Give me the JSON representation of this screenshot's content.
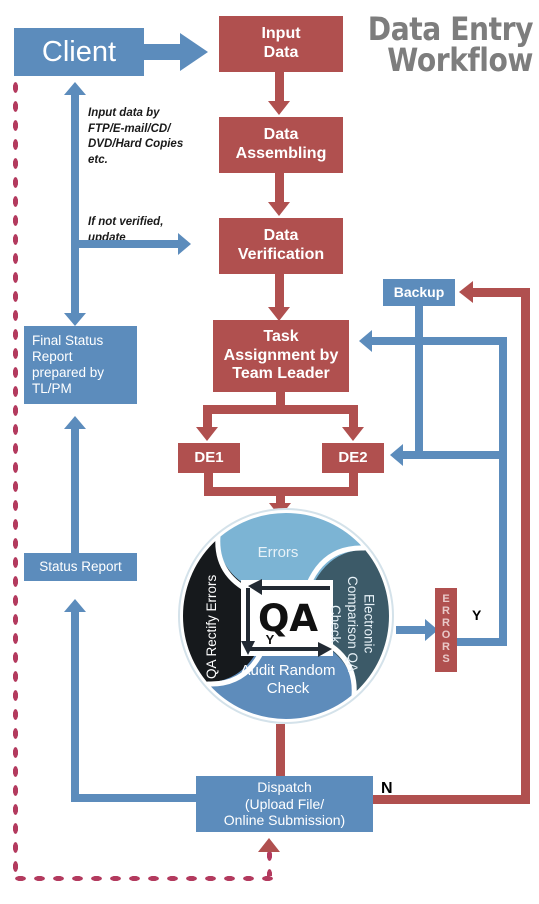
{
  "title": {
    "line1": "Data Entry",
    "line2": "Workflow"
  },
  "nodes": {
    "client": "Client",
    "input_data": "Input\nData",
    "input_data_l1": "Input",
    "input_data_l2": "Data",
    "data_assembling_l1": "Data",
    "data_assembling_l2": "Assembling",
    "data_verification_l1": "Data",
    "data_verification_l2": "Verification",
    "task_assignment_l1": "Task",
    "task_assignment_l2": "Assignment by",
    "task_assignment_l3": "Team Leader",
    "de1": "DE1",
    "de2": "DE2",
    "backup": "Backup",
    "final_status_report": "Final Status Report prepared by TL/PM",
    "status_report": "Status Report",
    "dispatch_l1": "Dispatch",
    "dispatch_l2": "(Upload File/",
    "dispatch_l3": "Online Submission)",
    "errors_vertical": "ERRORS",
    "errors_letters": [
      "E",
      "R",
      "R",
      "O",
      "R",
      "S"
    ]
  },
  "annotations": {
    "input_method": "Input data by FTP/E-mail/CD/ DVD/Hard Copies etc.",
    "not_verified": "If not verified, update",
    "yes_label": "Y",
    "no_label": "N",
    "qa_yes_label": "Y"
  },
  "qa_circle": {
    "center_label": "QA",
    "quadrants": [
      {
        "id": "errors",
        "label": "Errors",
        "color": "#7cb4d4",
        "position": "top"
      },
      {
        "id": "electronic-comparison",
        "label": "Electronic Comparison QA Check",
        "color": "#3c5a68",
        "position": "right"
      },
      {
        "id": "audit-random-check",
        "label": "Audit Random Check",
        "color": "#5e8cbb",
        "position": "bottom"
      },
      {
        "id": "qa-rectify-errors",
        "label": "QA Rectify Errors",
        "color": "#16191c",
        "position": "left"
      }
    ]
  },
  "colors": {
    "red": "#b0504f",
    "blue": "#5c8cbc",
    "title_gray": "#7d7d7d",
    "dot_red": "#b33a5e",
    "light_blue": "#7cb4d4",
    "dark_slate": "#3c5a68",
    "mid_blue": "#5e8cbb",
    "near_black": "#16191c"
  }
}
